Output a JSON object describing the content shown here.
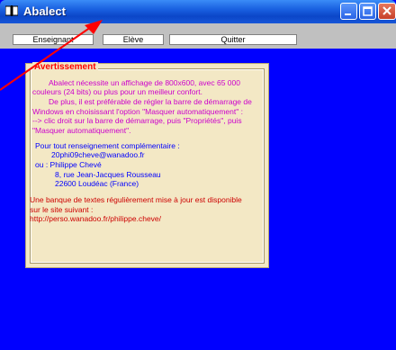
{
  "window": {
    "title": "Abalect",
    "colors": {
      "background": "#0000ff",
      "panel": "#f3e8c5",
      "warning": "#ff0000",
      "text_magenta": "#cc00cc",
      "text_blue": "#0000ff",
      "text_red": "#cc0000"
    }
  },
  "titlebar": {
    "icons": [
      "book-icon",
      "minimize-icon",
      "maximize-icon",
      "close-icon"
    ]
  },
  "menu": {
    "enseignant": "Enseignant",
    "eleve": "Elève",
    "quitter": "Quitter"
  },
  "panel": {
    "legend": "Avertissement",
    "para1": [
      "Abalect nécessite un affichage de 800x600, avec 65 000",
      "couleurs (24 bits) ou plus pour un meilleur confort."
    ],
    "para2": [
      "De plus, il est préférable de régler la barre de démarrage de",
      "Windows en choisissant l'option \"Masquer automatiquement\" :",
      "--> clic droit sur la barre de démarrage, puis \"Propriétés\", puis",
      "\"Masquer automatiquement\"."
    ],
    "contact": [
      "Pour tout renseignement complémentaire :",
      "20phi09cheve@wanadoo.fr",
      "ou : Philippe Chevé",
      "8, rue Jean-Jacques Rousseau",
      "22600 Loudéac (France)"
    ],
    "update": [
      "Une banque de textes régulièrement mise à jour est disponible",
      "sur le site suivant :",
      "http://perso.wanadoo.fr/philippe.cheve/"
    ]
  }
}
